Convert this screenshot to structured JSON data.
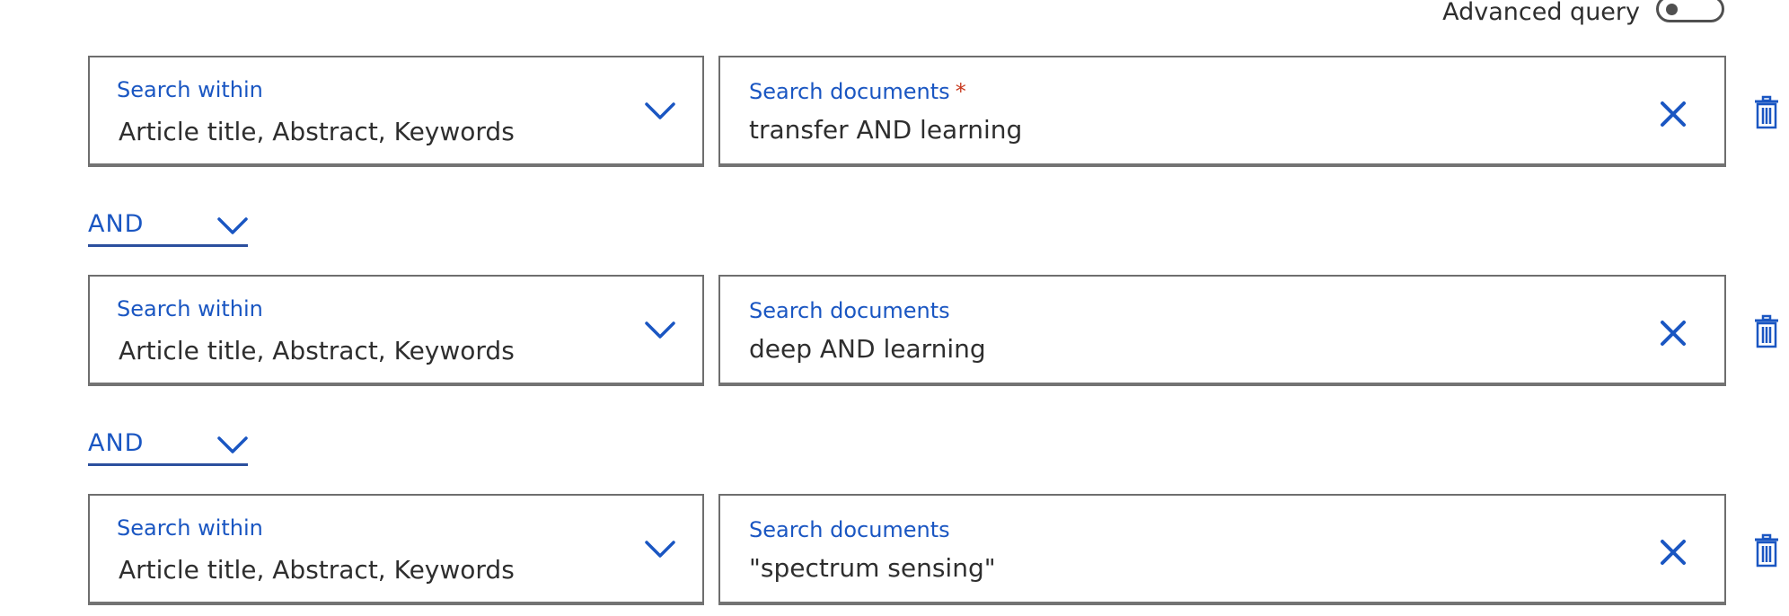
{
  "advanced_query": {
    "label": "Advanced query",
    "enabled": false
  },
  "search_rows": [
    {
      "within_label": "Search within",
      "within_value": "Article title, Abstract, Keywords",
      "docs_label": "Search documents",
      "required_mark": "*",
      "docs_value": "transfer AND learning"
    },
    {
      "within_label": "Search within",
      "within_value": "Article title, Abstract, Keywords",
      "docs_label": "Search documents",
      "required_mark": "",
      "docs_value": "deep AND learning"
    },
    {
      "within_label": "Search within",
      "within_value": "Article title, Abstract, Keywords",
      "docs_label": "Search documents",
      "required_mark": "",
      "docs_value": "\"spectrum sensing\""
    }
  ],
  "operators": [
    {
      "value": "AND"
    },
    {
      "value": "AND"
    }
  ],
  "colors": {
    "accent": "#1a56c2",
    "required": "#c83a1f",
    "border": "#6e6e6e",
    "text": "#2e2e2e"
  },
  "icons": {
    "field_dropdown": "chevron-down-icon",
    "clear": "close-icon",
    "remove_row": "trash-icon",
    "operator_dropdown": "chevron-down-icon"
  }
}
